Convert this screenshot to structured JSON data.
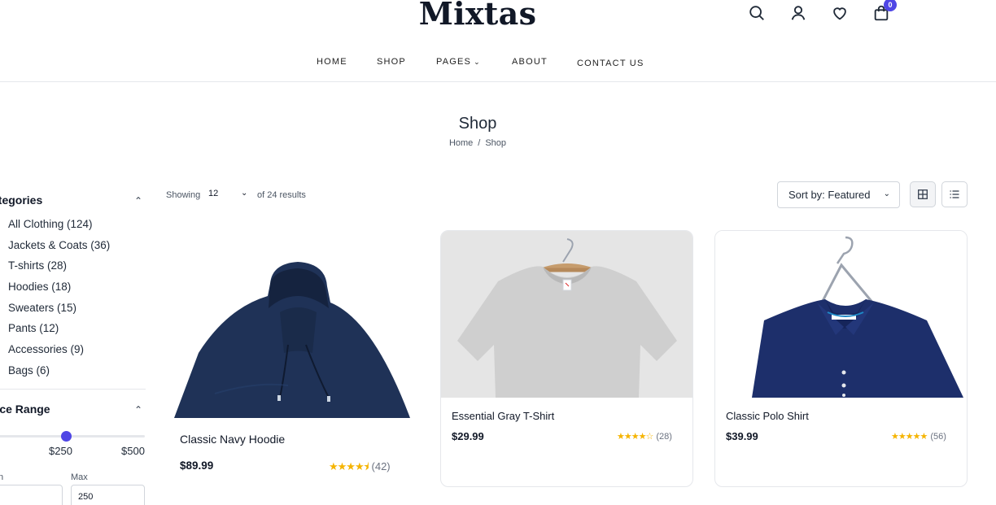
{
  "brand": {
    "name": "Mixtas",
    "accent": "#4f46e5",
    "star_color": "#f5b400"
  },
  "header": {
    "icons": [
      "search-icon",
      "user-icon",
      "heart-icon",
      "cart-icon"
    ],
    "cart_count": "0"
  },
  "nav": {
    "items": [
      {
        "label": "HOME"
      },
      {
        "label": "SHOP"
      },
      {
        "label": "PAGES",
        "has_dropdown": true
      },
      {
        "label": "ABOUT"
      },
      {
        "label": "CONTACT US"
      }
    ]
  },
  "page": {
    "title": "Shop",
    "breadcrumb": [
      "Home",
      "Shop"
    ],
    "breadcrumb_sep": "/"
  },
  "sidebar": {
    "categories_heading": "ategories",
    "categories": [
      "All Clothing (124)",
      "Jackets & Coats (36)",
      "T-shirts (28)",
      "Hoodies (18)",
      "Sweaters (15)",
      "Pants (12)",
      "Accessories (9)",
      "Bags (6)"
    ],
    "price_heading": "rice Range",
    "price_range": {
      "current_label": "$250",
      "max_label": "$500",
      "value": 250,
      "max": 500
    },
    "min_label": "n",
    "max_label": "Max",
    "max_value": "250"
  },
  "toolbar": {
    "showing_label": "Showing",
    "per_page": "12",
    "results_text": "of 24 results",
    "sort_label": "Sort by: Featured",
    "view_modes": [
      "grid-view-icon",
      "list-view-icon"
    ],
    "active_view": "grid"
  },
  "products": [
    {
      "name": "Classic Navy Hoodie",
      "price": "$89.99",
      "stars": "★★★★⯨",
      "rating": 4.5,
      "reviews": "(42)"
    },
    {
      "name": "Essential Gray T-Shirt",
      "price": "$29.99",
      "stars": "★★★★☆",
      "rating": 4,
      "reviews": "(28)"
    },
    {
      "name": "Classic Polo Shirt",
      "price": "$39.99",
      "stars": "★★★★★",
      "rating": 5,
      "reviews": "(56)"
    }
  ]
}
